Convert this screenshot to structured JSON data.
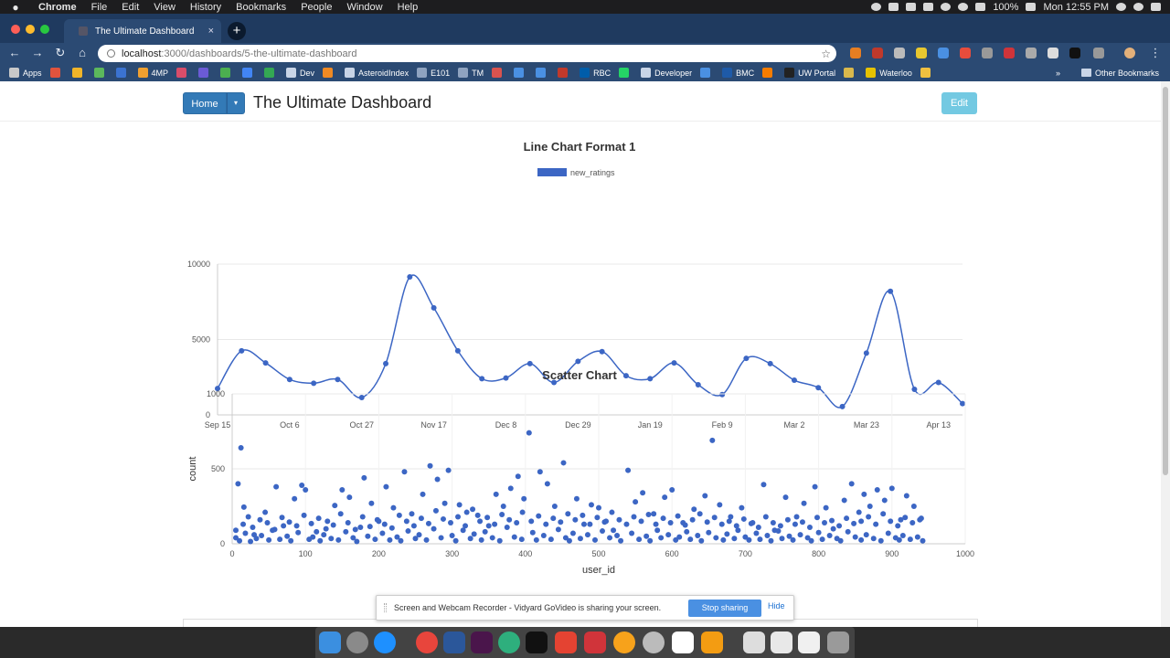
{
  "menubar": {
    "apple": "",
    "items": [
      "Chrome",
      "File",
      "Edit",
      "View",
      "History",
      "Bookmarks",
      "People",
      "Window",
      "Help"
    ],
    "battery": "100%",
    "clock": "Mon 12:55 PM"
  },
  "browser": {
    "tab_title": "The Ultimate Dashboard",
    "tab_close": "×",
    "new_tab": "+",
    "url_host": "localhost",
    "url_path": ":3000/dashboards/5-the-ultimate-dashboard",
    "bookmarks": [
      {
        "label": "Apps",
        "color": "#c9c9c9"
      },
      {
        "label": "",
        "color": "#e0533d"
      },
      {
        "label": "",
        "color": "#f0b429"
      },
      {
        "label": "",
        "color": "#5cb85c"
      },
      {
        "label": "",
        "color": "#3b73d1"
      },
      {
        "label": "4MP",
        "color": "#f0a030"
      },
      {
        "label": "",
        "color": "#d94d6a"
      },
      {
        "label": "",
        "color": "#6b5bd6"
      },
      {
        "label": "",
        "color": "#4caf50"
      },
      {
        "label": "",
        "color": "#4285f4"
      },
      {
        "label": "",
        "color": "#34a853"
      },
      {
        "label": "Dev",
        "color": "#c8d4e6"
      },
      {
        "label": "",
        "color": "#f08a24"
      },
      {
        "label": "AsteroidIndex",
        "color": "#c8d4e6"
      },
      {
        "label": "E101",
        "color": "#8fa3c0"
      },
      {
        "label": "TM",
        "color": "#8fa3c0"
      },
      {
        "label": "",
        "color": "#d9534f"
      },
      {
        "label": "",
        "color": "#4a90e2"
      },
      {
        "label": "",
        "color": "#4a90e2"
      },
      {
        "label": "",
        "color": "#c0392b"
      },
      {
        "label": "RBC",
        "color": "#005daa"
      },
      {
        "label": "",
        "color": "#25d366"
      },
      {
        "label": "Developer",
        "color": "#c8d4e6"
      },
      {
        "label": "",
        "color": "#4a90e2"
      },
      {
        "label": "BMC",
        "color": "#1e5aa8"
      },
      {
        "label": "",
        "color": "#f57c00"
      },
      {
        "label": "UW Portal",
        "color": "#222222"
      },
      {
        "label": "",
        "color": "#d9b84c"
      },
      {
        "label": "Waterloo",
        "color": "#e6c200"
      },
      {
        "label": "",
        "color": "#f0c040"
      }
    ],
    "other_bookmarks": "Other Bookmarks",
    "overflow": "»"
  },
  "header": {
    "home_label": "Home",
    "caret": "▾",
    "title": "The Ultimate Dashboard",
    "edit_label": "Edit"
  },
  "colors": {
    "accent": "#3c66c4",
    "primary_button": "#337ab7",
    "info_button": "#5bc0de"
  },
  "line_chart_title": "Line Chart Format 1",
  "scatter_chart_title": "Scatter Chart",
  "sharebar": {
    "message": "Screen and Webcam Recorder - Vidyard GoVideo is sharing your screen.",
    "stop_label": "Stop sharing",
    "hide_label": "Hide"
  },
  "chart_data": [
    {
      "type": "line",
      "title": "Line Chart Format 1",
      "series": [
        {
          "name": "new_ratings",
          "x": [
            "Sep 15",
            "Sep 22",
            "Sep 29",
            "Oct 6",
            "Oct 13",
            "Oct 20",
            "Oct 27",
            "Nov 3",
            "Nov 10",
            "Nov 17",
            "Nov 24",
            "Dec 1",
            "Dec 8",
            "Dec 15",
            "Dec 22",
            "Dec 29",
            "Jan 5",
            "Jan 12",
            "Jan 19",
            "Jan 26",
            "Feb 2",
            "Feb 9",
            "Feb 16",
            "Feb 23",
            "Mar 2",
            "Mar 9",
            "Mar 16",
            "Mar 23",
            "Mar 30",
            "Apr 6",
            "Apr 13",
            "Apr 20"
          ],
          "values": [
            1750,
            4250,
            3450,
            2350,
            2100,
            2350,
            1150,
            3400,
            9150,
            7100,
            4250,
            2400,
            2450,
            3400,
            2150,
            3550,
            4200,
            2600,
            2400,
            3450,
            2000,
            1350,
            3750,
            3400,
            2300,
            1800,
            550,
            4100,
            8200,
            1700,
            2150,
            750
          ]
        }
      ],
      "xticks": [
        "Sep 15",
        "Oct 6",
        "Oct 27",
        "Nov 17",
        "Dec 8",
        "Dec 29",
        "Jan 19",
        "Feb 9",
        "Mar 2",
        "Mar 23",
        "Apr 13"
      ],
      "yticks": [
        0,
        5000,
        10000
      ],
      "ylim": [
        0,
        10000
      ],
      "legend": "top-center",
      "grid": true
    },
    {
      "type": "scatter",
      "title": "Scatter Chart",
      "xlabel": "user_id",
      "ylabel": "count",
      "xlim": [
        0,
        1000
      ],
      "ylim": [
        0,
        1000
      ],
      "xticks": [
        0,
        100,
        200,
        300,
        400,
        500,
        600,
        700,
        800,
        900,
        1000
      ],
      "yticks": [
        0,
        500,
        1000
      ],
      "grid": true,
      "points": [
        [
          12,
          640
        ],
        [
          8,
          400
        ],
        [
          16,
          245
        ],
        [
          22,
          180
        ],
        [
          5,
          90
        ],
        [
          30,
          60
        ],
        [
          45,
          210
        ],
        [
          60,
          380
        ],
        [
          70,
          120
        ],
        [
          85,
          300
        ],
        [
          95,
          390
        ],
        [
          100,
          360
        ],
        [
          115,
          80
        ],
        [
          130,
          150
        ],
        [
          140,
          255
        ],
        [
          150,
          360
        ],
        [
          160,
          310
        ],
        [
          175,
          110
        ],
        [
          180,
          440
        ],
        [
          190,
          270
        ],
        [
          200,
          150
        ],
        [
          210,
          380
        ],
        [
          220,
          240
        ],
        [
          235,
          480
        ],
        [
          245,
          200
        ],
        [
          260,
          330
        ],
        [
          270,
          520
        ],
        [
          280,
          430
        ],
        [
          290,
          270
        ],
        [
          295,
          490
        ],
        [
          310,
          260
        ],
        [
          320,
          210
        ],
        [
          335,
          190
        ],
        [
          350,
          120
        ],
        [
          360,
          330
        ],
        [
          370,
          250
        ],
        [
          380,
          370
        ],
        [
          390,
          450
        ],
        [
          398,
          300
        ],
        [
          405,
          740
        ],
        [
          420,
          480
        ],
        [
          430,
          400
        ],
        [
          440,
          250
        ],
        [
          452,
          540
        ],
        [
          470,
          300
        ],
        [
          480,
          130
        ],
        [
          490,
          260
        ],
        [
          500,
          240
        ],
        [
          510,
          150
        ],
        [
          520,
          90
        ],
        [
          540,
          490
        ],
        [
          550,
          280
        ],
        [
          560,
          340
        ],
        [
          575,
          200
        ],
        [
          590,
          310
        ],
        [
          600,
          360
        ],
        [
          615,
          140
        ],
        [
          630,
          230
        ],
        [
          645,
          320
        ],
        [
          655,
          690
        ],
        [
          665,
          260
        ],
        [
          680,
          180
        ],
        [
          695,
          240
        ],
        [
          710,
          140
        ],
        [
          725,
          395
        ],
        [
          740,
          90
        ],
        [
          755,
          310
        ],
        [
          770,
          180
        ],
        [
          780,
          270
        ],
        [
          795,
          380
        ],
        [
          810,
          240
        ],
        [
          820,
          100
        ],
        [
          835,
          290
        ],
        [
          845,
          400
        ],
        [
          855,
          210
        ],
        [
          862,
          330
        ],
        [
          870,
          250
        ],
        [
          880,
          360
        ],
        [
          890,
          290
        ],
        [
          900,
          370
        ],
        [
          912,
          160
        ],
        [
          920,
          320
        ],
        [
          930,
          250
        ],
        [
          940,
          170
        ],
        [
          5,
          40
        ],
        [
          10,
          20
        ],
        [
          18,
          70
        ],
        [
          25,
          15
        ],
        [
          33,
          35
        ],
        [
          40,
          55
        ],
        [
          50,
          25
        ],
        [
          55,
          90
        ],
        [
          65,
          30
        ],
        [
          75,
          50
        ],
        [
          80,
          20
        ],
        [
          90,
          75
        ],
        [
          105,
          30
        ],
        [
          110,
          45
        ],
        [
          120,
          20
        ],
        [
          125,
          60
        ],
        [
          135,
          35
        ],
        [
          145,
          25
        ],
        [
          155,
          80
        ],
        [
          165,
          40
        ],
        [
          170,
          15
        ],
        [
          185,
          50
        ],
        [
          195,
          30
        ],
        [
          205,
          70
        ],
        [
          215,
          25
        ],
        [
          225,
          45
        ],
        [
          230,
          20
        ],
        [
          240,
          85
        ],
        [
          250,
          35
        ],
        [
          255,
          60
        ],
        [
          265,
          25
        ],
        [
          275,
          100
        ],
        [
          285,
          40
        ],
        [
          300,
          55
        ],
        [
          305,
          20
        ],
        [
          315,
          90
        ],
        [
          325,
          35
        ],
        [
          330,
          65
        ],
        [
          340,
          25
        ],
        [
          345,
          80
        ],
        [
          355,
          40
        ],
        [
          365,
          20
        ],
        [
          375,
          110
        ],
        [
          385,
          45
        ],
        [
          395,
          30
        ],
        [
          410,
          75
        ],
        [
          415,
          25
        ],
        [
          425,
          55
        ],
        [
          435,
          30
        ],
        [
          445,
          95
        ],
        [
          455,
          40
        ],
        [
          460,
          20
        ],
        [
          465,
          70
        ],
        [
          475,
          35
        ],
        [
          485,
          60
        ],
        [
          495,
          25
        ],
        [
          505,
          85
        ],
        [
          515,
          40
        ],
        [
          525,
          55
        ],
        [
          530,
          20
        ],
        [
          545,
          70
        ],
        [
          555,
          30
        ],
        [
          565,
          50
        ],
        [
          570,
          20
        ],
        [
          580,
          90
        ],
        [
          585,
          40
        ],
        [
          595,
          60
        ],
        [
          605,
          25
        ],
        [
          610,
          45
        ],
        [
          620,
          80
        ],
        [
          625,
          30
        ],
        [
          635,
          55
        ],
        [
          640,
          20
        ],
        [
          650,
          75
        ],
        [
          660,
          40
        ],
        [
          670,
          25
        ],
        [
          675,
          65
        ],
        [
          685,
          35
        ],
        [
          690,
          90
        ],
        [
          700,
          45
        ],
        [
          705,
          25
        ],
        [
          715,
          70
        ],
        [
          720,
          30
        ],
        [
          730,
          55
        ],
        [
          735,
          20
        ],
        [
          745,
          85
        ],
        [
          750,
          35
        ],
        [
          760,
          50
        ],
        [
          765,
          25
        ],
        [
          775,
          60
        ],
        [
          785,
          40
        ],
        [
          790,
          20
        ],
        [
          800,
          75
        ],
        [
          805,
          30
        ],
        [
          815,
          55
        ],
        [
          825,
          35
        ],
        [
          830,
          20
        ],
        [
          840,
          80
        ],
        [
          850,
          45
        ],
        [
          858,
          25
        ],
        [
          865,
          60
        ],
        [
          875,
          35
        ],
        [
          885,
          20
        ],
        [
          895,
          70
        ],
        [
          905,
          40
        ],
        [
          910,
          25
        ],
        [
          915,
          55
        ],
        [
          925,
          30
        ],
        [
          935,
          45
        ],
        [
          942,
          20
        ],
        [
          15,
          130
        ],
        [
          28,
          110
        ],
        [
          38,
          160
        ],
        [
          48,
          140
        ],
        [
          58,
          95
        ],
        [
          68,
          175
        ],
        [
          78,
          145
        ],
        [
          88,
          120
        ],
        [
          98,
          190
        ],
        [
          108,
          135
        ],
        [
          118,
          170
        ],
        [
          128,
          100
        ],
        [
          138,
          125
        ],
        [
          148,
          200
        ],
        [
          158,
          140
        ],
        [
          168,
          95
        ],
        [
          178,
          180
        ],
        [
          188,
          115
        ],
        [
          198,
          160
        ],
        [
          208,
          130
        ],
        [
          218,
          105
        ],
        [
          228,
          190
        ],
        [
          238,
          150
        ],
        [
          248,
          120
        ],
        [
          258,
          170
        ],
        [
          268,
          135
        ],
        [
          278,
          220
        ],
        [
          288,
          165
        ],
        [
          298,
          140
        ],
        [
          308,
          180
        ],
        [
          318,
          120
        ],
        [
          328,
          230
        ],
        [
          338,
          150
        ],
        [
          348,
          175
        ],
        [
          358,
          130
        ],
        [
          368,
          195
        ],
        [
          378,
          160
        ],
        [
          388,
          140
        ],
        [
          396,
          210
        ],
        [
          408,
          150
        ],
        [
          418,
          185
        ],
        [
          428,
          130
        ],
        [
          438,
          170
        ],
        [
          448,
          145
        ],
        [
          458,
          200
        ],
        [
          468,
          160
        ],
        [
          478,
          190
        ],
        [
          488,
          130
        ],
        [
          498,
          175
        ],
        [
          508,
          145
        ],
        [
          518,
          210
        ],
        [
          528,
          160
        ],
        [
          538,
          130
        ],
        [
          548,
          180
        ],
        [
          558,
          150
        ],
        [
          568,
          195
        ],
        [
          578,
          130
        ],
        [
          588,
          170
        ],
        [
          598,
          140
        ],
        [
          608,
          185
        ],
        [
          618,
          125
        ],
        [
          628,
          160
        ],
        [
          638,
          200
        ],
        [
          648,
          145
        ],
        [
          658,
          175
        ],
        [
          668,
          130
        ],
        [
          678,
          150
        ],
        [
          688,
          120
        ],
        [
          698,
          165
        ],
        [
          708,
          135
        ],
        [
          718,
          110
        ],
        [
          728,
          180
        ],
        [
          738,
          140
        ],
        [
          748,
          120
        ],
        [
          758,
          160
        ],
        [
          768,
          130
        ],
        [
          778,
          145
        ],
        [
          788,
          110
        ],
        [
          798,
          175
        ],
        [
          808,
          140
        ],
        [
          818,
          155
        ],
        [
          828,
          120
        ],
        [
          838,
          170
        ],
        [
          848,
          135
        ],
        [
          858,
          150
        ],
        [
          868,
          180
        ],
        [
          878,
          130
        ],
        [
          888,
          200
        ],
        [
          898,
          150
        ],
        [
          908,
          120
        ],
        [
          918,
          175
        ],
        [
          928,
          140
        ],
        [
          938,
          160
        ]
      ]
    }
  ]
}
